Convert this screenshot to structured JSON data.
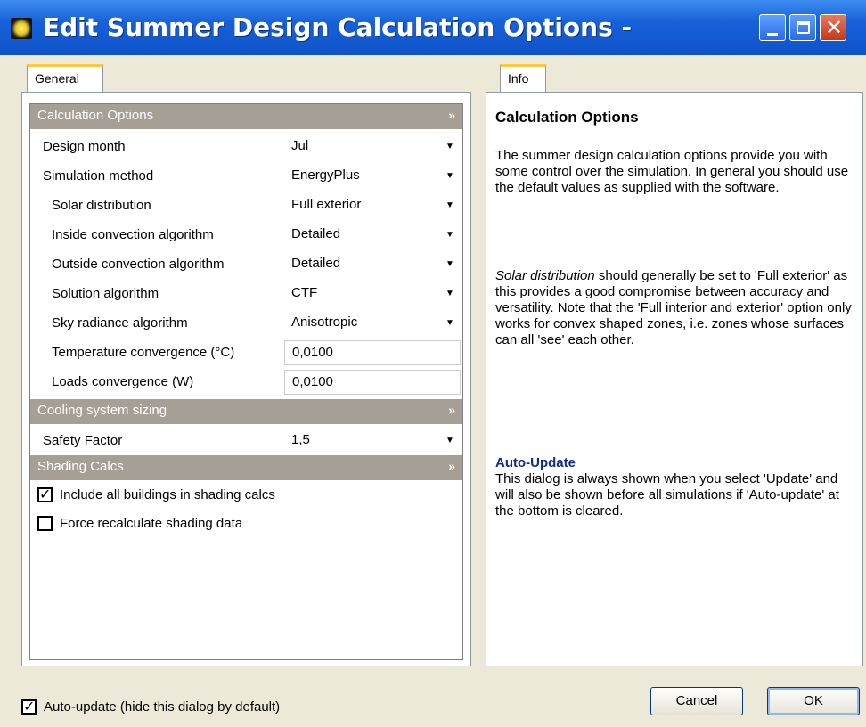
{
  "window": {
    "title": "Edit Summer Design Calculation Options -",
    "buttons": [
      "minimize",
      "maximize",
      "close"
    ]
  },
  "tabs": {
    "left": "General",
    "right": "Info"
  },
  "sections": [
    {
      "header": "Calculation Options",
      "rows": [
        {
          "label": "Design month",
          "value": "Jul",
          "type": "dropdown"
        },
        {
          "label": "Simulation method",
          "value": "EnergyPlus",
          "type": "dropdown"
        },
        {
          "label": "Solar distribution",
          "value": "Full exterior",
          "type": "dropdown"
        },
        {
          "label": "Inside convection algorithm",
          "value": "Detailed",
          "type": "dropdown"
        },
        {
          "label": "Outside convection algorithm",
          "value": "Detailed",
          "type": "dropdown"
        },
        {
          "label": "Solution algorithm",
          "value": "CTF",
          "type": "dropdown"
        },
        {
          "label": "Sky radiance algorithm",
          "value": "Anisotropic",
          "type": "dropdown"
        },
        {
          "label": "Temperature convergence (°C)",
          "value": "0,0100",
          "type": "text"
        },
        {
          "label": "Loads convergence (W)",
          "value": "0,0100",
          "type": "text"
        }
      ]
    },
    {
      "header": "Cooling system sizing",
      "rows": [
        {
          "label": "Safety Factor",
          "value": "1,5",
          "type": "dropdown"
        }
      ]
    },
    {
      "header": "Shading Calcs",
      "checks": [
        {
          "label": "Include all buildings in shading calcs",
          "checked": true
        },
        {
          "label": "Force recalculate shading data",
          "checked": false
        }
      ]
    }
  ],
  "info": {
    "title": "Calculation Options",
    "p1": "The summer design calculation options provide you with some control over the simulation.  In general you should use the default values as supplied with the software.",
    "p2_em": "Solar distribution",
    "p2_rest": " should generally be set to 'Full exterior' as this provides a good compromise between accuracy and versatility.  Note that the 'Full interior and exterior' option only works for convex shaped zones, i.e. zones whose surfaces can all 'see' each other.",
    "h2": "Auto-Update",
    "p3": "This dialog is always shown when you select 'Update' and will also be shown before all simulations if 'Auto-update' at the bottom is cleared."
  },
  "bottom": {
    "auto_update_label": "Auto-update (hide this dialog by default)",
    "auto_update_checked": true,
    "cancel": "Cancel",
    "ok": "OK"
  }
}
